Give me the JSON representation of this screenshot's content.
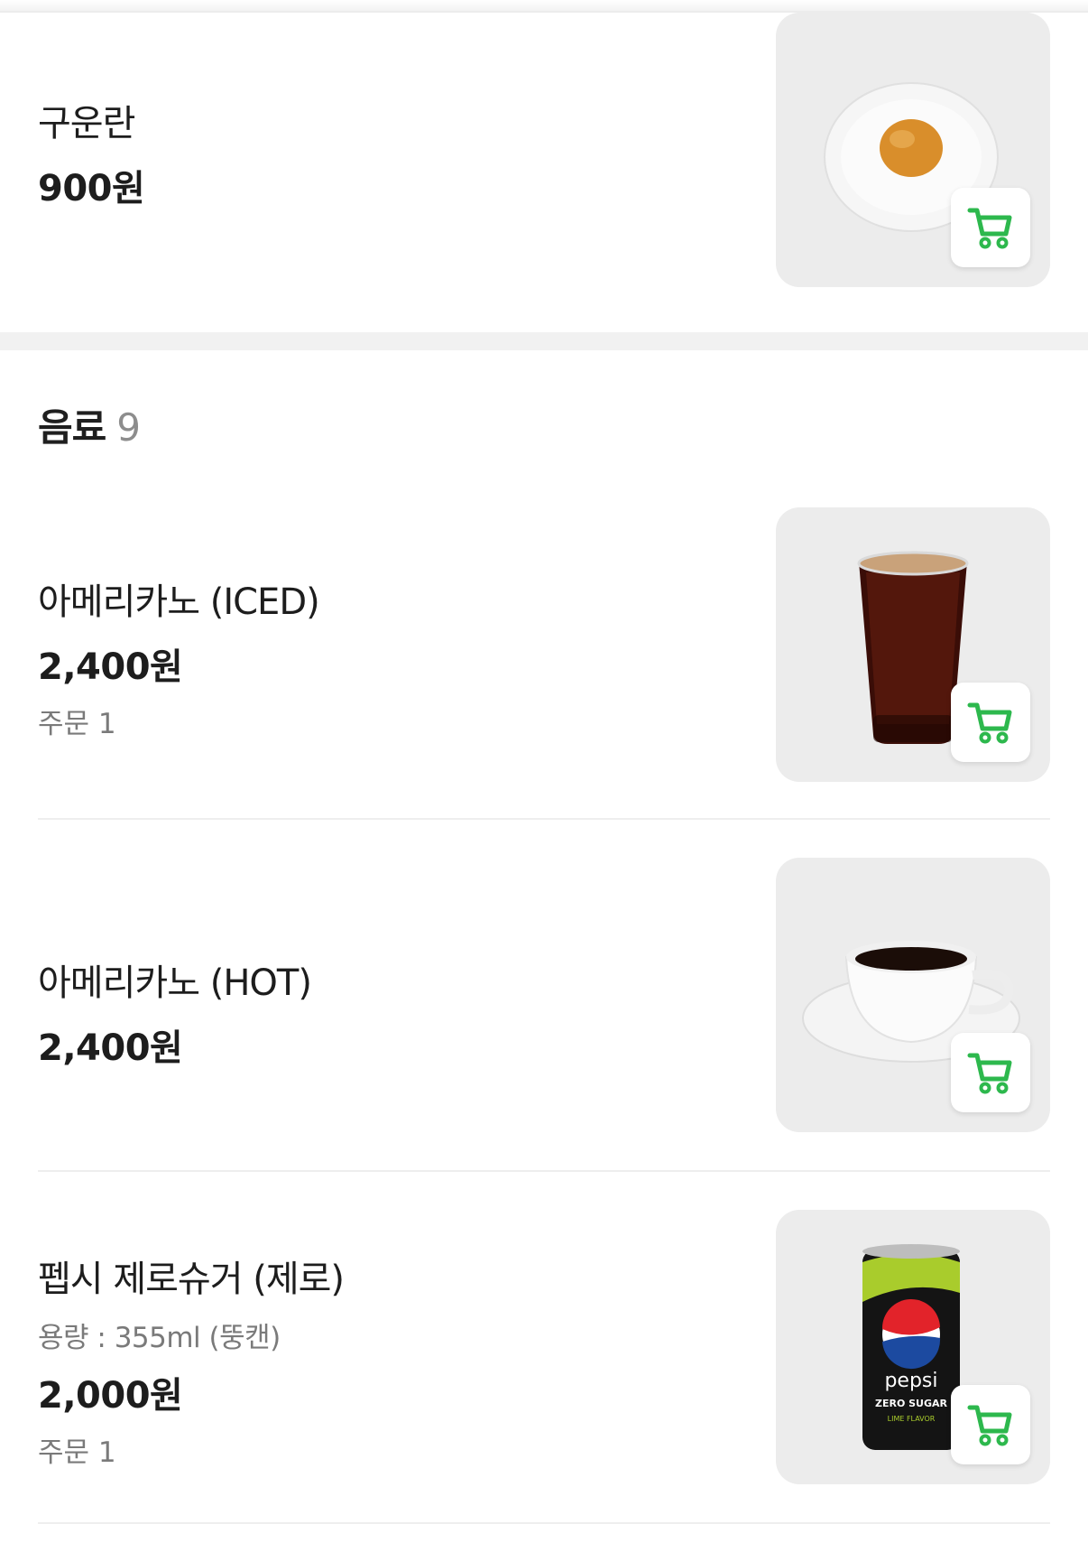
{
  "items_top": [
    {
      "name": "구운란",
      "price": "900원"
    }
  ],
  "section": {
    "title": "음료",
    "count": "9"
  },
  "drinks": [
    {
      "name": "아메리카노 (ICED)",
      "price": "2,400원",
      "orders": "주문 1"
    },
    {
      "name": "아메리카노 (HOT)",
      "price": "2,400원"
    },
    {
      "name": "펩시 제로슈거 (제로)",
      "desc": "용량 : 355ml (뚱캔)",
      "price": "2,000원",
      "orders": "주문 1"
    }
  ],
  "pepsi_can": {
    "brand": "pepsi",
    "line1": "ZERO SUGAR",
    "line2": "LIME FLAVOR"
  },
  "icons": {
    "cart": "cart-icon"
  },
  "colors": {
    "accent": "#2db84d",
    "thumb_bg": "#ececec",
    "divider": "#eeeeee"
  }
}
